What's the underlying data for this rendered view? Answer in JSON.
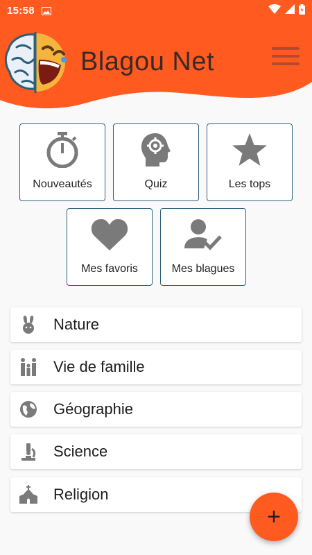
{
  "status_bar": {
    "time": "15:58"
  },
  "header": {
    "title": "Blagou Net"
  },
  "tiles": [
    {
      "label": "Nouveautés",
      "icon": "stopwatch-icon"
    },
    {
      "label": "Quiz",
      "icon": "head-gear-icon"
    },
    {
      "label": "Les tops",
      "icon": "star-icon"
    },
    {
      "label": "Mes favoris",
      "icon": "heart-icon"
    },
    {
      "label": "Mes blagues",
      "icon": "user-check-icon"
    }
  ],
  "categories": [
    {
      "label": "Nature",
      "icon": "rabbit-icon"
    },
    {
      "label": "Vie de famille",
      "icon": "family-icon"
    },
    {
      "label": "Géographie",
      "icon": "globe-icon"
    },
    {
      "label": "Science",
      "icon": "microscope-icon"
    },
    {
      "label": "Religion",
      "icon": "church-icon"
    }
  ],
  "fab": {
    "label": "+"
  },
  "colors": {
    "accent": "#ff5a1f",
    "tile_border": "#2d5f7a",
    "icon_gray": "#7a7a7a"
  }
}
